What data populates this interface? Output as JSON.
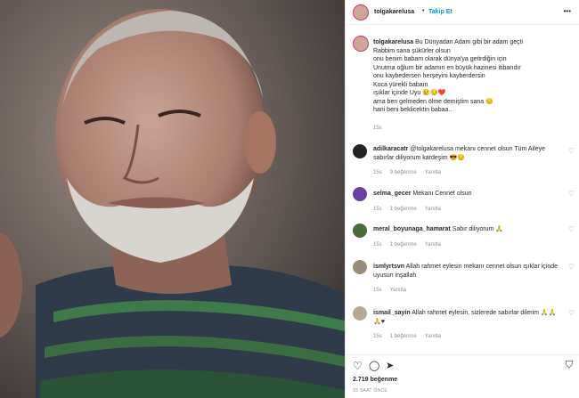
{
  "post": {
    "username": "tolgakarelusa",
    "follow_label": "Takip Et",
    "more_label": "•••",
    "caption_lines": [
      "Bu Dünyadan Adam gibi bir adam geçti",
      "Rabbim sana şükürler olsun",
      "onu benim babam olarak dünya'ya getirdiğin için",
      "Unutma oğlum bir adamın en büyük hazinesi itibarıdır",
      "onu kaybedersen herşeyini kayberdersin",
      "Koca yürekli babam",
      "ışıklar içinde Uyu 😢😔❤️",
      "ama ben gelmeden ölme demiştim sana 😔",
      "hani beni beklicektin babaa.."
    ],
    "caption_time": "15s"
  },
  "comments": [
    {
      "user": "adilkaracatr",
      "text": "@tolgakarelusa mekanı cennet olsun Tüm Aileye sabırlar diliyorum kardeşim 😎😔",
      "time": "15s",
      "likes": "9 beğenme",
      "reply": "Yanıtla"
    },
    {
      "user": "selma_gecer",
      "text": "Mekanı Cennet olsun",
      "time": "15s",
      "likes": "1 beğenme",
      "reply": "Yanıtla"
    },
    {
      "user": "meral_boyunaga_hamarat",
      "text": "Sabır diliyorum 🙏",
      "time": "15s",
      "likes": "1 beğenme",
      "reply": "Yanıtla"
    },
    {
      "user": "ismlyrtsvn",
      "text": "Allah rahmet eylesin mekanı cennet olsun ışıklar içinde uyusun inşallah",
      "time": "15s",
      "likes": "",
      "reply": "Yanıtla"
    },
    {
      "user": "ismail_sayin",
      "text": "Allah rahmet eylesin, sizlerede sabırlar dilerim 🙏🙏🙏♥",
      "time": "15s",
      "likes": "1 beğenme",
      "reply": "Yanıtla"
    }
  ],
  "footer": {
    "likes": "2.719 beğenme",
    "time": "15 SAAT ÖNCE"
  },
  "icons": {
    "heart": "♡",
    "comment": "◯",
    "share": "➤",
    "bookmark": "⛉"
  }
}
